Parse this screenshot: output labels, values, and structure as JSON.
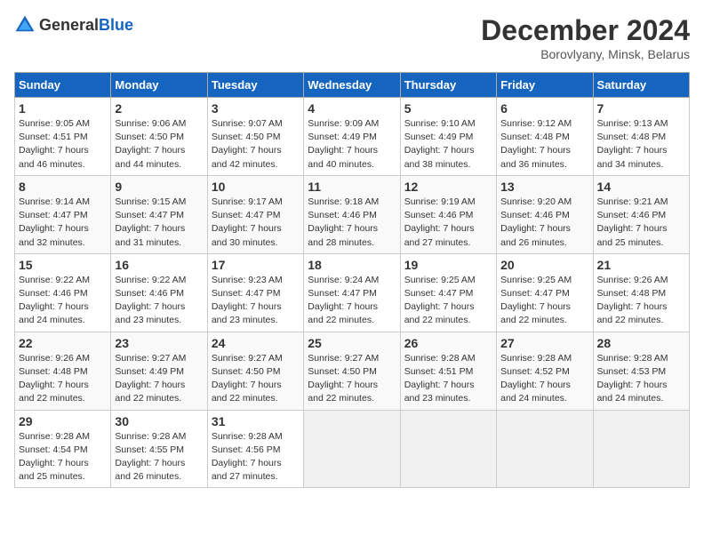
{
  "header": {
    "logo_general": "General",
    "logo_blue": "Blue",
    "title": "December 2024",
    "subtitle": "Borovlyany, Minsk, Belarus"
  },
  "columns": [
    "Sunday",
    "Monday",
    "Tuesday",
    "Wednesday",
    "Thursday",
    "Friday",
    "Saturday"
  ],
  "weeks": [
    [
      {
        "day": "1",
        "sunrise": "9:05 AM",
        "sunset": "4:51 PM",
        "daylight": "7 hours and 46 minutes."
      },
      {
        "day": "2",
        "sunrise": "9:06 AM",
        "sunset": "4:50 PM",
        "daylight": "7 hours and 44 minutes."
      },
      {
        "day": "3",
        "sunrise": "9:07 AM",
        "sunset": "4:50 PM",
        "daylight": "7 hours and 42 minutes."
      },
      {
        "day": "4",
        "sunrise": "9:09 AM",
        "sunset": "4:49 PM",
        "daylight": "7 hours and 40 minutes."
      },
      {
        "day": "5",
        "sunrise": "9:10 AM",
        "sunset": "4:49 PM",
        "daylight": "7 hours and 38 minutes."
      },
      {
        "day": "6",
        "sunrise": "9:12 AM",
        "sunset": "4:48 PM",
        "daylight": "7 hours and 36 minutes."
      },
      {
        "day": "7",
        "sunrise": "9:13 AM",
        "sunset": "4:48 PM",
        "daylight": "7 hours and 34 minutes."
      }
    ],
    [
      {
        "day": "8",
        "sunrise": "9:14 AM",
        "sunset": "4:47 PM",
        "daylight": "7 hours and 32 minutes."
      },
      {
        "day": "9",
        "sunrise": "9:15 AM",
        "sunset": "4:47 PM",
        "daylight": "7 hours and 31 minutes."
      },
      {
        "day": "10",
        "sunrise": "9:17 AM",
        "sunset": "4:47 PM",
        "daylight": "7 hours and 30 minutes."
      },
      {
        "day": "11",
        "sunrise": "9:18 AM",
        "sunset": "4:46 PM",
        "daylight": "7 hours and 28 minutes."
      },
      {
        "day": "12",
        "sunrise": "9:19 AM",
        "sunset": "4:46 PM",
        "daylight": "7 hours and 27 minutes."
      },
      {
        "day": "13",
        "sunrise": "9:20 AM",
        "sunset": "4:46 PM",
        "daylight": "7 hours and 26 minutes."
      },
      {
        "day": "14",
        "sunrise": "9:21 AM",
        "sunset": "4:46 PM",
        "daylight": "7 hours and 25 minutes."
      }
    ],
    [
      {
        "day": "15",
        "sunrise": "9:22 AM",
        "sunset": "4:46 PM",
        "daylight": "7 hours and 24 minutes."
      },
      {
        "day": "16",
        "sunrise": "9:22 AM",
        "sunset": "4:46 PM",
        "daylight": "7 hours and 23 minutes."
      },
      {
        "day": "17",
        "sunrise": "9:23 AM",
        "sunset": "4:47 PM",
        "daylight": "7 hours and 23 minutes."
      },
      {
        "day": "18",
        "sunrise": "9:24 AM",
        "sunset": "4:47 PM",
        "daylight": "7 hours and 22 minutes."
      },
      {
        "day": "19",
        "sunrise": "9:25 AM",
        "sunset": "4:47 PM",
        "daylight": "7 hours and 22 minutes."
      },
      {
        "day": "20",
        "sunrise": "9:25 AM",
        "sunset": "4:47 PM",
        "daylight": "7 hours and 22 minutes."
      },
      {
        "day": "21",
        "sunrise": "9:26 AM",
        "sunset": "4:48 PM",
        "daylight": "7 hours and 22 minutes."
      }
    ],
    [
      {
        "day": "22",
        "sunrise": "9:26 AM",
        "sunset": "4:48 PM",
        "daylight": "7 hours and 22 minutes."
      },
      {
        "day": "23",
        "sunrise": "9:27 AM",
        "sunset": "4:49 PM",
        "daylight": "7 hours and 22 minutes."
      },
      {
        "day": "24",
        "sunrise": "9:27 AM",
        "sunset": "4:50 PM",
        "daylight": "7 hours and 22 minutes."
      },
      {
        "day": "25",
        "sunrise": "9:27 AM",
        "sunset": "4:50 PM",
        "daylight": "7 hours and 22 minutes."
      },
      {
        "day": "26",
        "sunrise": "9:28 AM",
        "sunset": "4:51 PM",
        "daylight": "7 hours and 23 minutes."
      },
      {
        "day": "27",
        "sunrise": "9:28 AM",
        "sunset": "4:52 PM",
        "daylight": "7 hours and 24 minutes."
      },
      {
        "day": "28",
        "sunrise": "9:28 AM",
        "sunset": "4:53 PM",
        "daylight": "7 hours and 24 minutes."
      }
    ],
    [
      {
        "day": "29",
        "sunrise": "9:28 AM",
        "sunset": "4:54 PM",
        "daylight": "7 hours and 25 minutes."
      },
      {
        "day": "30",
        "sunrise": "9:28 AM",
        "sunset": "4:55 PM",
        "daylight": "7 hours and 26 minutes."
      },
      {
        "day": "31",
        "sunrise": "9:28 AM",
        "sunset": "4:56 PM",
        "daylight": "7 hours and 27 minutes."
      },
      null,
      null,
      null,
      null
    ]
  ]
}
